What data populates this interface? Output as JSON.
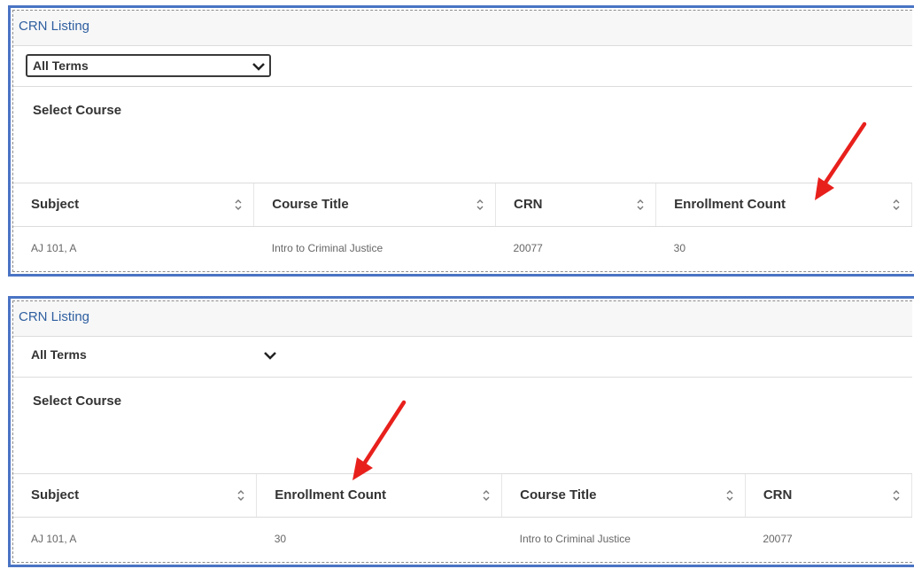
{
  "panels": [
    {
      "title": "CRN Listing",
      "term_dropdown": {
        "selected": "All Terms",
        "icon": "chevron-down-icon"
      },
      "section_label": "Select Course",
      "columns": [
        "Subject",
        "Course Title",
        "CRN",
        "Enrollment Count"
      ],
      "rows": [
        [
          "AJ 101, A",
          "Intro to Criminal Justice",
          "20077",
          "30"
        ]
      ],
      "annotation_color": "#e8201c"
    },
    {
      "title": "CRN Listing",
      "term_dropdown": {
        "selected": "All Terms",
        "icon": "chevron-down-icon"
      },
      "section_label": "Select Course",
      "columns": [
        "Subject",
        "Enrollment Count",
        "Course Title",
        "CRN"
      ],
      "rows": [
        [
          "AJ 101, A",
          "30",
          "Intro to Criminal Justice",
          "20077"
        ]
      ],
      "annotation_color": "#e8201c"
    }
  ],
  "colors": {
    "panel_border": "#4a74c4",
    "title_text": "#2f5fa0",
    "header_bg": "#f7f7f7"
  }
}
